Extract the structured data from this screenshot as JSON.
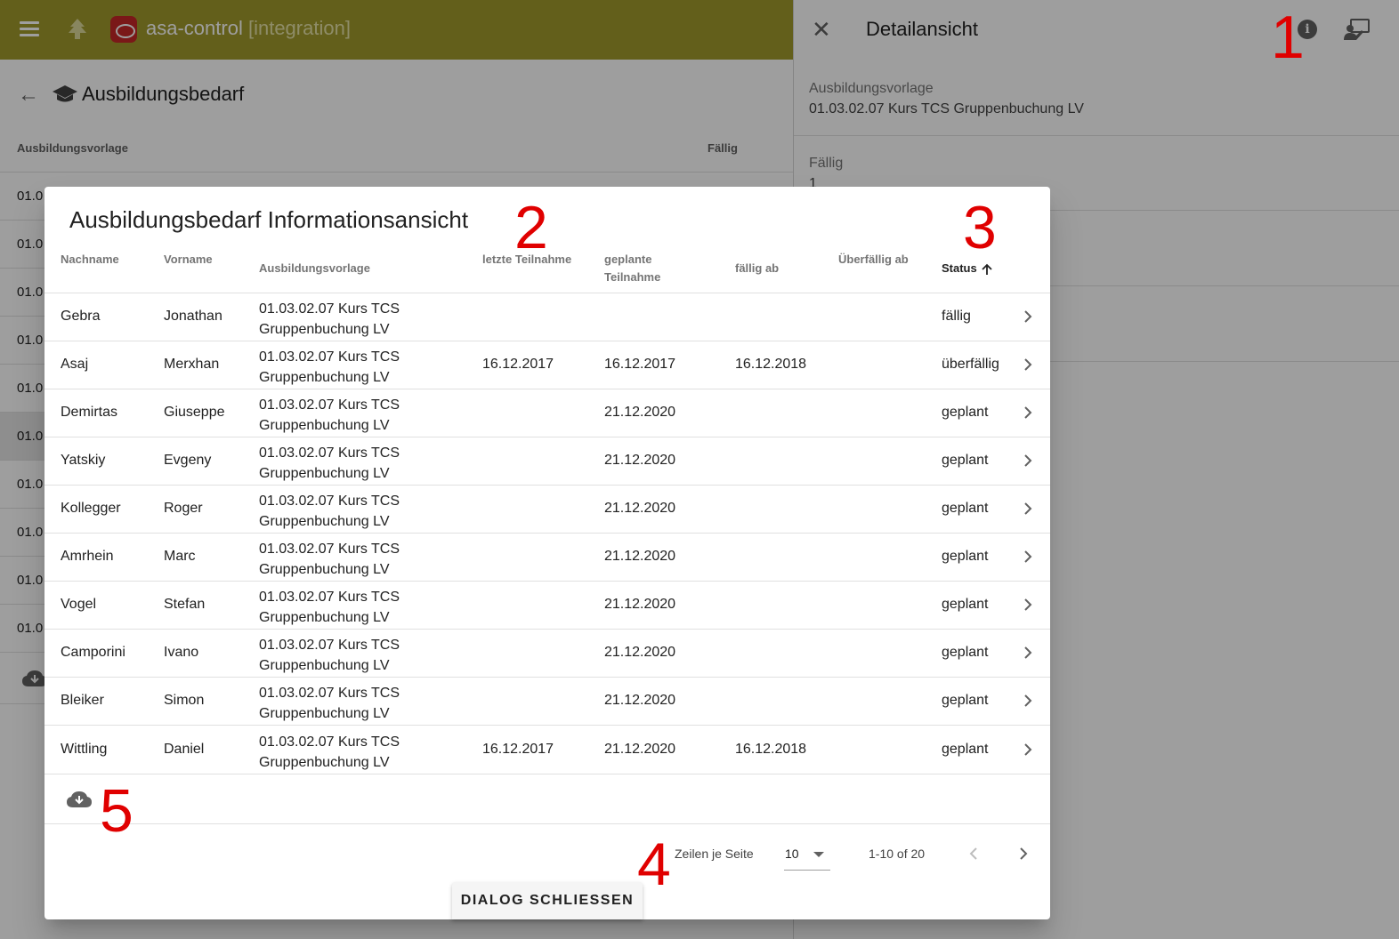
{
  "app": {
    "title": "asa-control",
    "environment": "[integration]",
    "page_title": "Ausbildungsbedarf",
    "table_headers": [
      "Ausbildungsvorlage",
      "Fällig"
    ],
    "row_prefixes": [
      "01.0",
      "01.0",
      "01.0",
      "01.0",
      "01.0",
      "01.0",
      "01.0",
      "01.0",
      "01.0",
      "01.0"
    ],
    "header_color": "#a19a2c"
  },
  "detail": {
    "title": "Detailansicht",
    "fields": [
      {
        "label": "Ausbildungsvorlage",
        "value": "01.03.02.07 Kurs TCS Gruppenbuchung LV"
      },
      {
        "label": "Fällig",
        "value": "1"
      }
    ]
  },
  "dialog": {
    "title": "Ausbildungsbedarf Informationsansicht",
    "columns": {
      "nachname": "Nachname",
      "vorname": "Vorname",
      "vorlage": "Ausbildungsvorlage",
      "letzte": "letzte Teilnahme",
      "geplante_1": "geplante",
      "geplante_2": "Teilnahme",
      "faellig": "fällig ab",
      "ueberfaellig": "Überfällig ab",
      "status": "Status"
    },
    "rows": [
      {
        "nachname": "Gebra",
        "vorname": "Jonathan",
        "vorlage_1": "01.03.02.07 Kurs TCS",
        "vorlage_2": "Gruppenbuchung LV",
        "letzte": "",
        "geplante": "",
        "faellig": "",
        "ueberfaellig": "",
        "status": "fällig"
      },
      {
        "nachname": "Asaj",
        "vorname": "Merxhan",
        "vorlage_1": "01.03.02.07 Kurs TCS",
        "vorlage_2": "Gruppenbuchung LV",
        "letzte": "16.12.2017",
        "geplante": "16.12.2017",
        "faellig": "16.12.2018",
        "ueberfaellig": "",
        "status": "überfällig"
      },
      {
        "nachname": "Demirtas",
        "vorname": "Giuseppe",
        "vorlage_1": "01.03.02.07 Kurs TCS",
        "vorlage_2": "Gruppenbuchung LV",
        "letzte": "",
        "geplante": "21.12.2020",
        "faellig": "",
        "ueberfaellig": "",
        "status": "geplant"
      },
      {
        "nachname": "Yatskiy",
        "vorname": "Evgeny",
        "vorlage_1": "01.03.02.07 Kurs TCS",
        "vorlage_2": "Gruppenbuchung LV",
        "letzte": "",
        "geplante": "21.12.2020",
        "faellig": "",
        "ueberfaellig": "",
        "status": "geplant"
      },
      {
        "nachname": "Kollegger",
        "vorname": "Roger",
        "vorlage_1": "01.03.02.07 Kurs TCS",
        "vorlage_2": "Gruppenbuchung LV",
        "letzte": "",
        "geplante": "21.12.2020",
        "faellig": "",
        "ueberfaellig": "",
        "status": "geplant"
      },
      {
        "nachname": "Amrhein",
        "vorname": "Marc",
        "vorlage_1": "01.03.02.07 Kurs TCS",
        "vorlage_2": "Gruppenbuchung LV",
        "letzte": "",
        "geplante": "21.12.2020",
        "faellig": "",
        "ueberfaellig": "",
        "status": "geplant"
      },
      {
        "nachname": "Vogel",
        "vorname": "Stefan",
        "vorlage_1": "01.03.02.07 Kurs TCS",
        "vorlage_2": "Gruppenbuchung LV",
        "letzte": "",
        "geplante": "21.12.2020",
        "faellig": "",
        "ueberfaellig": "",
        "status": "geplant"
      },
      {
        "nachname": "Camporini",
        "vorname": "Ivano",
        "vorlage_1": "01.03.02.07 Kurs TCS",
        "vorlage_2": "Gruppenbuchung LV",
        "letzte": "",
        "geplante": "21.12.2020",
        "faellig": "",
        "ueberfaellig": "",
        "status": "geplant"
      },
      {
        "nachname": "Bleiker",
        "vorname": "Simon",
        "vorlage_1": "01.03.02.07 Kurs TCS",
        "vorlage_2": "Gruppenbuchung LV",
        "letzte": "",
        "geplante": "21.12.2020",
        "faellig": "",
        "ueberfaellig": "",
        "status": "geplant"
      },
      {
        "nachname": "Wittling",
        "vorname": "Daniel",
        "vorlage_1": "01.03.02.07 Kurs TCS",
        "vorlage_2": "Gruppenbuchung LV",
        "letzte": "16.12.2017",
        "geplante": "21.12.2020",
        "faellig": "16.12.2018",
        "ueberfaellig": "",
        "status": "geplant"
      }
    ],
    "rows_per_page_label": "Zeilen je Seite",
    "rows_per_page_value": "10",
    "range_label": "1-10 of 20",
    "close_label": "DIALOG SCHLIESSEN"
  },
  "annotations": [
    "1",
    "2",
    "3",
    "4",
    "5"
  ],
  "colors": {
    "annotation": "#e00000",
    "overlay": "rgba(0,0,0,0.38)"
  }
}
